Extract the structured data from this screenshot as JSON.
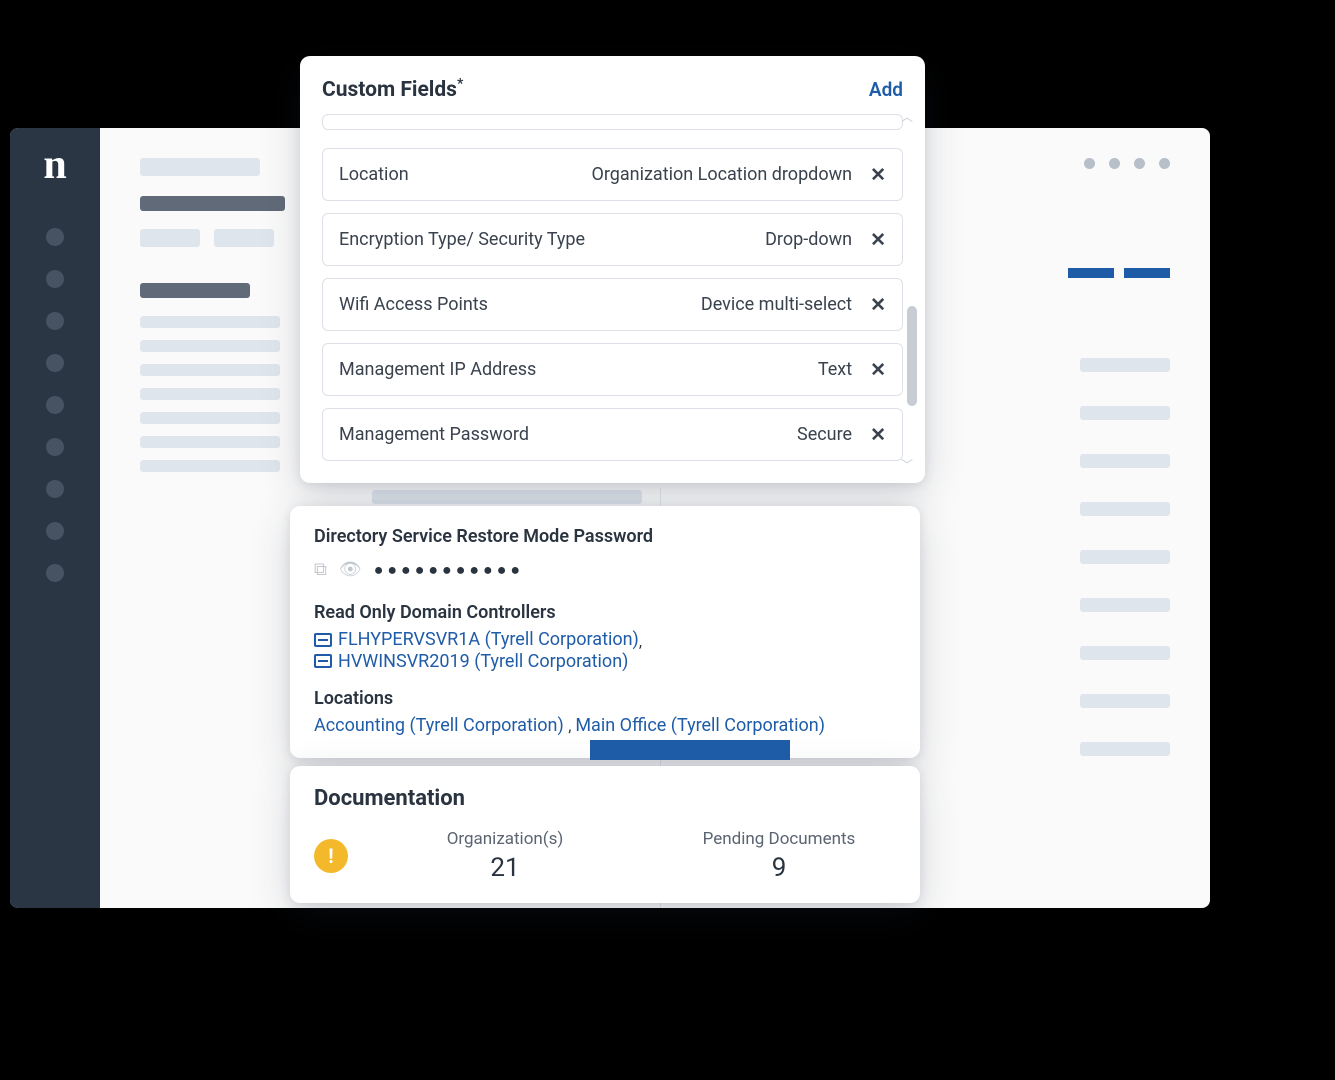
{
  "app": {
    "logo_text": "n"
  },
  "custom_fields": {
    "title": "Custom Fields",
    "title_marker": "*",
    "add_label": "Add",
    "rows": [
      {
        "name": "Location",
        "type": "Organization Location dropdown"
      },
      {
        "name": "Encryption Type/ Security Type",
        "type": "Drop-down"
      },
      {
        "name": "Wifi Access Points",
        "type": "Device multi-select"
      },
      {
        "name": "Management IP Address",
        "type": "Text"
      },
      {
        "name": "Management Password",
        "type": "Secure"
      }
    ]
  },
  "details": {
    "dsrm_heading": "Directory Service Restore Mode Password",
    "password_mask": "●●●●●●●●●●●",
    "rodc_heading": "Read Only Domain Controllers",
    "controllers": [
      {
        "name": "FLHYPERVSVR1A",
        "org": "(Tyrell Corporation)"
      },
      {
        "name": "HVWINSVR2019",
        "org": "(Tyrell Corporation)"
      }
    ],
    "locations_heading": "Locations",
    "locations": [
      {
        "name": "Accounting",
        "org": "(Tyrell Corporation)"
      },
      {
        "name": "Main Office",
        "org": "(Tyrell Corporation)"
      }
    ]
  },
  "documentation": {
    "title": "Documentation",
    "org_label": "Organization(s)",
    "org_count": "21",
    "pending_label": "Pending Documents",
    "pending_count": "9"
  }
}
